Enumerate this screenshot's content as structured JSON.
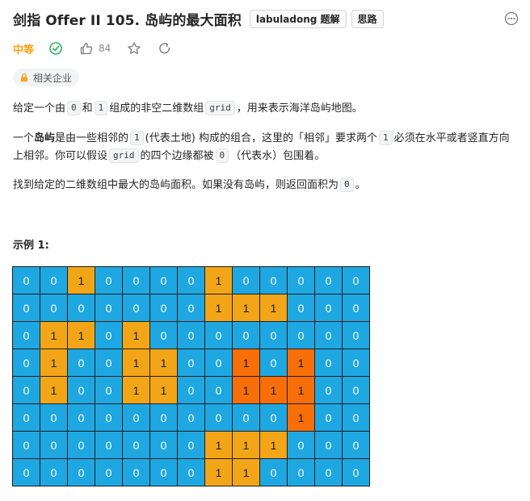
{
  "header": {
    "title": "剑指 Offer II 105. 岛屿的最大面积",
    "tags": [
      "labuladong 题解",
      "思路"
    ]
  },
  "meta": {
    "difficulty": "中等",
    "difficulty_color": "#ffa116",
    "likes": "84",
    "icons": [
      "check-circle-icon",
      "thumbs-up-icon",
      "star-icon",
      "share-icon",
      "more-icon"
    ]
  },
  "company": {
    "label": "相关企业",
    "icon": "lock-icon"
  },
  "description": {
    "p1": {
      "t1": "给定一个由",
      "c1": "0",
      "t2": "和",
      "c2": "1",
      "t3": "组成的非空二维数组",
      "c3": "grid",
      "t4": "，用来表示海洋岛屿地图。"
    },
    "p2": {
      "t1": "一个",
      "b1": "岛屿",
      "t2": "是由一些相邻的",
      "c1": "1",
      "t3": "(代表土地) 构成的组合，这里的「相邻」要求两个",
      "c2": "1",
      "t4": "必须在水平或者竖直方向上相邻。你可以假设",
      "c3": "grid",
      "t5": "的四个边缘都被",
      "c4": "0",
      "t6": "（代表水）包围着。"
    },
    "p3": {
      "t1": "找到给定的二维数组中最大的岛屿面积。如果没有岛屿，则返回面积为",
      "c1": "0",
      "t2": "。"
    }
  },
  "example": {
    "title": "示例 1:",
    "colors": {
      "water": "#1ea7e1",
      "land": "#f2a516",
      "largest_island": "#f86e08"
    },
    "grid": [
      [
        0,
        0,
        1,
        0,
        0,
        0,
        0,
        1,
        0,
        0,
        0,
        0,
        0
      ],
      [
        0,
        0,
        0,
        0,
        0,
        0,
        0,
        1,
        1,
        1,
        0,
        0,
        0
      ],
      [
        0,
        1,
        1,
        0,
        1,
        0,
        0,
        0,
        0,
        0,
        0,
        0,
        0
      ],
      [
        0,
        1,
        0,
        0,
        1,
        1,
        0,
        0,
        1,
        0,
        1,
        0,
        0
      ],
      [
        0,
        1,
        0,
        0,
        1,
        1,
        0,
        0,
        1,
        1,
        1,
        0,
        0
      ],
      [
        0,
        0,
        0,
        0,
        0,
        0,
        0,
        0,
        0,
        0,
        1,
        0,
        0
      ],
      [
        0,
        0,
        0,
        0,
        0,
        0,
        0,
        1,
        1,
        1,
        0,
        0,
        0
      ],
      [
        0,
        0,
        0,
        0,
        0,
        0,
        0,
        1,
        1,
        0,
        0,
        0,
        0
      ]
    ],
    "largest_island_cells": [
      [
        3,
        8
      ],
      [
        3,
        10
      ],
      [
        4,
        8
      ],
      [
        4,
        9
      ],
      [
        4,
        10
      ],
      [
        5,
        10
      ]
    ]
  }
}
